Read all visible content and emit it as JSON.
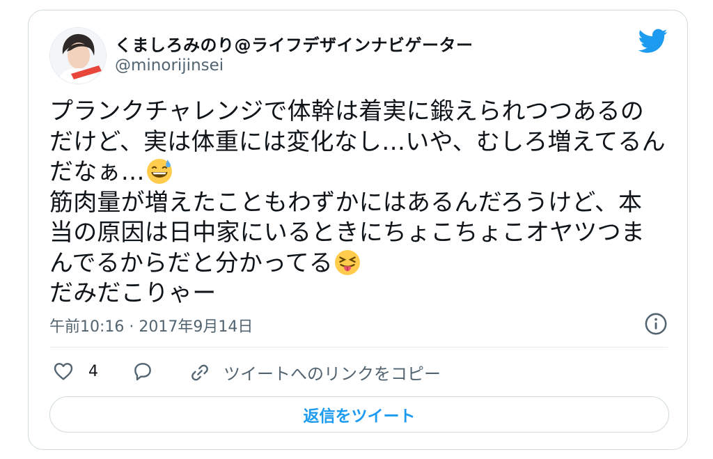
{
  "author": {
    "display_name": "くましろみのり@ライフデザインナビゲーター",
    "handle": "@minorijinsei"
  },
  "tweet": {
    "lines": [
      "プランクチャレンジで体幹は着実に鍛えられつつあるの",
      "だけど、実は体重には変化なし…いや、むしろ増えてるん",
      "だなぁ…",
      "筋肉量が増えたこともわずかにはあるんだろうけど、本",
      "当の原因は日中家にいるときにちょこちょこオヤツつま",
      "んでるからだと分かってる",
      "だみだこりゃー"
    ],
    "emojis": [
      "grinning-sweat-emoji",
      "squinting-tongue-emoji"
    ]
  },
  "meta": {
    "timestamp": "午前10:16 · 2017年9月14日"
  },
  "actions": {
    "like_count": "4",
    "copy_link_label": "ツイートへのリンクをコピー",
    "reply_button_label": "返信をツイート"
  },
  "colors": {
    "accent": "#1d9bf0",
    "secondary_text": "#536471",
    "border": "#cfd9de"
  }
}
